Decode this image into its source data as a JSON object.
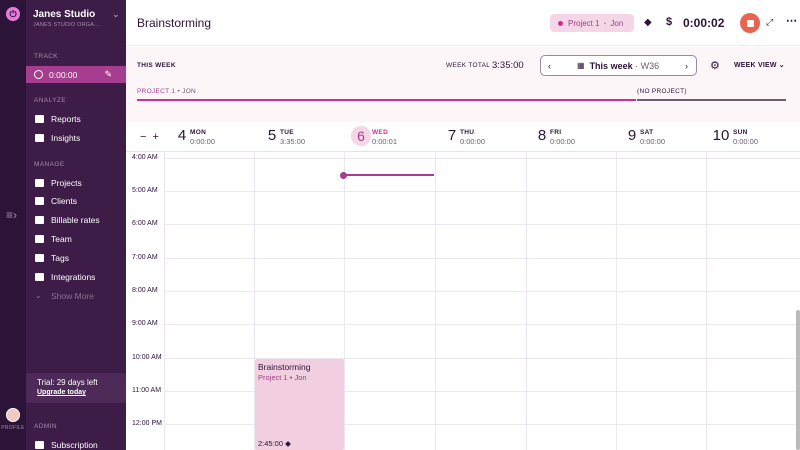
{
  "workspace": {
    "name": "Janes Studio",
    "org": "JANES STUDIO ORGA..."
  },
  "rail": {
    "profile_label": "PROFILE"
  },
  "sidebar": {
    "track_section": "TRACK",
    "running_time": "0:00:00",
    "analyze_section": "ANALYZE",
    "analyze_items": [
      {
        "label": "Reports",
        "icon": "reports-icon"
      },
      {
        "label": "Insights",
        "icon": "insights-icon"
      }
    ],
    "manage_section": "MANAGE",
    "manage_items": [
      {
        "label": "Projects",
        "icon": "folder-icon"
      },
      {
        "label": "Clients",
        "icon": "clients-icon"
      },
      {
        "label": "Billable rates",
        "icon": "billable-icon"
      },
      {
        "label": "Team",
        "icon": "team-icon"
      },
      {
        "label": "Tags",
        "icon": "tag-icon"
      },
      {
        "label": "Integrations",
        "icon": "plug-icon"
      }
    ],
    "show_more": "Show More",
    "trial_text": "Trial: 29 days left",
    "upgrade_label": "Upgrade today",
    "admin_section": "ADMIN",
    "admin_items": [
      {
        "label": "Subscription",
        "icon": "subscription-icon"
      }
    ]
  },
  "header": {
    "entry_title": "Brainstorming",
    "project": "Project 1",
    "client": "Jon",
    "timer": "0:00:02"
  },
  "toolbar": {
    "this_week_label": "THIS WEEK",
    "week_total_label": "WEEK TOTAL",
    "week_total_value": "3:35:00",
    "week_label": "This week",
    "week_number": "W36",
    "view_label": "WEEK VIEW",
    "bar1_project": "PROJECT 1",
    "bar1_client": "JON",
    "bar2_label": "(NO PROJECT)"
  },
  "days": [
    {
      "num": "4",
      "name": "MON",
      "total": "0:00:00"
    },
    {
      "num": "5",
      "name": "TUE",
      "total": "3:35:00"
    },
    {
      "num": "6",
      "name": "WED",
      "total": "0:00:01"
    },
    {
      "num": "7",
      "name": "THU",
      "total": "0:00:00"
    },
    {
      "num": "8",
      "name": "FRI",
      "total": "0:00:00"
    },
    {
      "num": "9",
      "name": "SAT",
      "total": "0:00:00"
    },
    {
      "num": "10",
      "name": "SUN",
      "total": "0:00:00"
    }
  ],
  "hours": [
    "4:00 AM",
    "5:00 AM",
    "6:00 AM",
    "7:00 AM",
    "8:00 AM",
    "9:00 AM",
    "10:00 AM",
    "11:00 AM",
    "12:00 PM"
  ],
  "entry": {
    "title": "Brainstorming",
    "project": "Project 1",
    "client": "Jon",
    "duration": "2:45:00"
  },
  "colors": {
    "accent": "#c8328f",
    "sidebar": "#3d1c47",
    "stop": "#e8664f",
    "entry_bg": "#f1cfe0"
  }
}
